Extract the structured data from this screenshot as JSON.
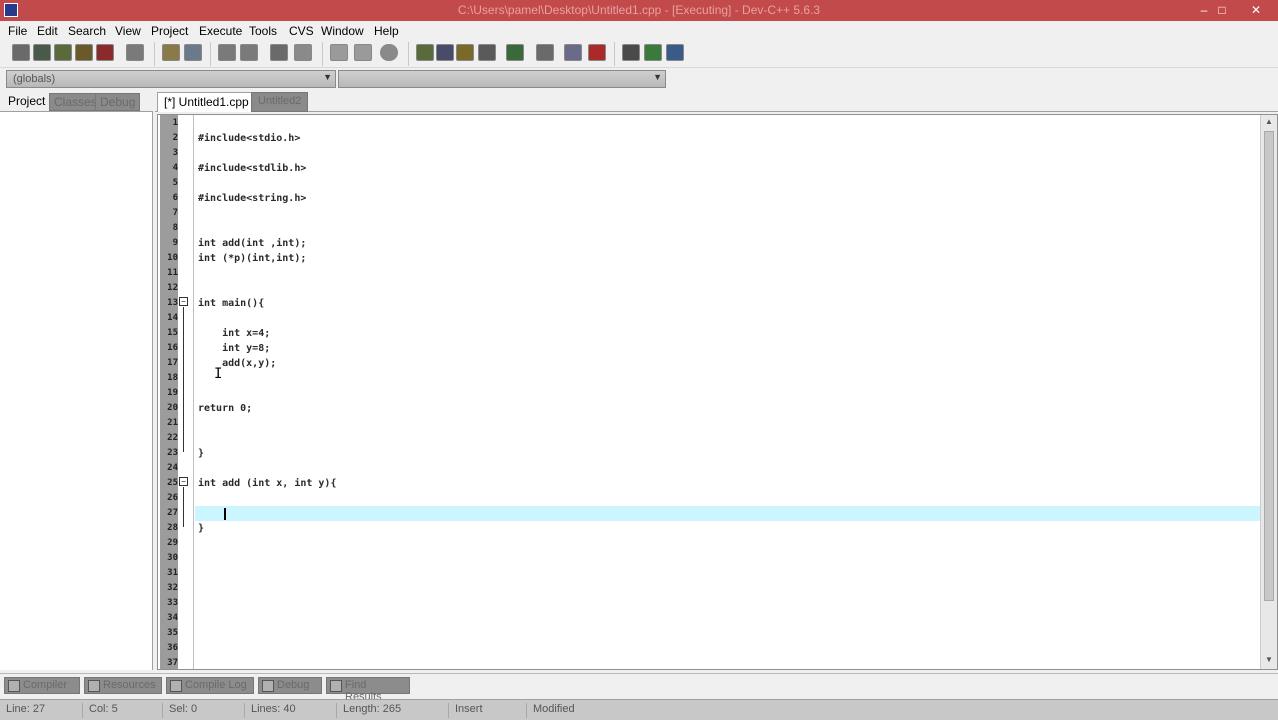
{
  "window": {
    "title": "C:\\Users\\pamel\\Desktop\\Untitled1.cpp - [Executing] - Dev-C++ 5.6.3",
    "minimize": "–",
    "maximize": "□",
    "close": "✕"
  },
  "menu": [
    "File",
    "Edit",
    "Search",
    "View",
    "Project",
    "Execute",
    "Tools",
    "CVS",
    "Window",
    "Help"
  ],
  "toolbar2": {
    "compiler": "(globals)",
    "function": ""
  },
  "left_tabs": [
    "Project",
    "Classes",
    "Debug"
  ],
  "editor_tabs": [
    "[*] Untitled1.cpp",
    "Untitled2"
  ],
  "code_lines": [
    "",
    "#include<stdio.h>",
    "",
    "#include<stdlib.h>",
    "",
    "#include<string.h>",
    "",
    "",
    "int add(int ,int);",
    "int (*p)(int,int);",
    "",
    "",
    "int main(){",
    "",
    "    int x=4;",
    "    int y=8;",
    "    add(x,y);",
    "",
    "",
    "return 0;",
    "",
    "",
    "}",
    "",
    "int add (int x, int y){",
    "",
    "    ",
    "}",
    "",
    "",
    "",
    "",
    "",
    "",
    "",
    "",
    ""
  ],
  "line_numbers": [
    "1",
    "2",
    "3",
    "4",
    "5",
    "6",
    "7",
    "8",
    "9",
    "10",
    "11",
    "12",
    "13",
    "14",
    "15",
    "16",
    "17",
    "18",
    "19",
    "20",
    "21",
    "22",
    "23",
    "24",
    "25",
    "26",
    "27",
    "28",
    "29",
    "30",
    "31",
    "32",
    "33",
    "34",
    "35",
    "36",
    "37"
  ],
  "bottom_tabs": [
    "Compiler",
    "Resources",
    "Compile Log",
    "Debug",
    "Find Results"
  ],
  "status": {
    "line": "Line: 27",
    "col": "Col: 5",
    "sel": "Sel: 0",
    "lines": "Lines: 40",
    "length": "Length: 265",
    "insert": "Insert",
    "modified": "Modified"
  }
}
